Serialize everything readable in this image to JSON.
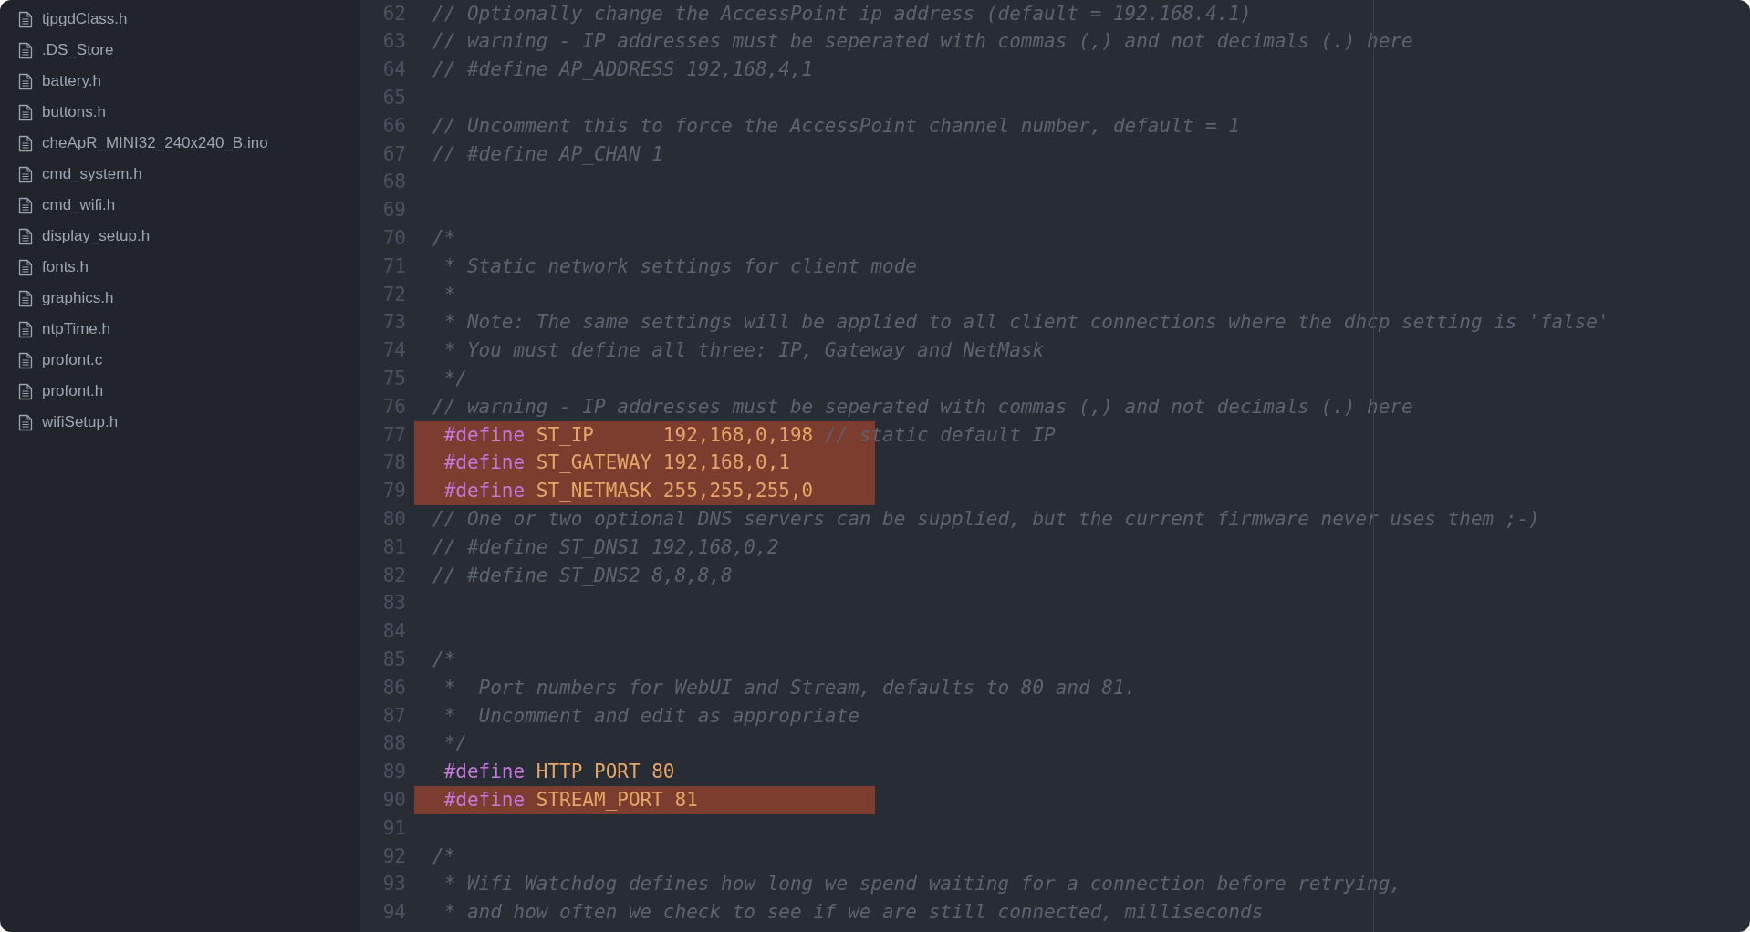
{
  "sidebar": {
    "tree": [
      {
        "children": [
          {
            "name": "tjpgdClass.h"
          }
        ]
      },
      {
        "name": ".DS_Store"
      },
      {
        "name": "battery.h"
      },
      {
        "name": "buttons.h"
      },
      {
        "name": "cheApR_MINI32_240x240_B.ino"
      },
      {
        "name": "cmd_system.h"
      },
      {
        "name": "cmd_wifi.h"
      },
      {
        "name": "display_setup.h"
      },
      {
        "name": "fonts.h"
      },
      {
        "name": "graphics.h"
      },
      {
        "name": "ntpTime.h"
      },
      {
        "name": "profont.c"
      },
      {
        "name": "profont.h"
      },
      {
        "name": "wifiSetup.h"
      }
    ]
  },
  "editor": {
    "lines": [
      {
        "number": "62",
        "highlighted": false,
        "tokens": [
          {
            "kind": "comment",
            "text": "// Optionally change the AccessPoint ip address (default = 192.168.4.1)"
          }
        ]
      },
      {
        "number": "63",
        "highlighted": false,
        "tokens": [
          {
            "kind": "comment",
            "text": "// warning - IP addresses must be seperated with commas (,) and not decimals (.) here"
          }
        ]
      },
      {
        "number": "64",
        "highlighted": false,
        "tokens": [
          {
            "kind": "comment",
            "text": "// #define AP_ADDRESS 192,168,4,1"
          }
        ]
      },
      {
        "number": "65",
        "highlighted": false
      },
      {
        "number": "66",
        "highlighted": false,
        "tokens": [
          {
            "kind": "comment",
            "text": "// Uncomment this to force the AccessPoint channel number, default = 1"
          }
        ]
      },
      {
        "number": "67",
        "highlighted": false,
        "tokens": [
          {
            "kind": "comment",
            "text": "// #define AP_CHAN 1"
          }
        ]
      },
      {
        "number": "68",
        "highlighted": false
      },
      {
        "number": "69",
        "highlighted": false
      },
      {
        "number": "70",
        "highlighted": false,
        "tokens": [
          {
            "kind": "comment",
            "text": "/*"
          }
        ]
      },
      {
        "number": "71",
        "highlighted": false,
        "tokens": [
          {
            "kind": "comment",
            "text": " * Static network settings for client mode"
          }
        ]
      },
      {
        "number": "72",
        "highlighted": false,
        "tokens": [
          {
            "kind": "comment",
            "text": " *"
          }
        ]
      },
      {
        "number": "73",
        "highlighted": false,
        "tokens": [
          {
            "kind": "comment",
            "text": " * Note: The same settings will be applied to all client connections where the dhcp setting is 'false'"
          }
        ]
      },
      {
        "number": "74",
        "highlighted": false,
        "tokens": [
          {
            "kind": "comment",
            "text": " * You must define all three: IP, Gateway and NetMask"
          }
        ]
      },
      {
        "number": "75",
        "highlighted": false,
        "tokens": [
          {
            "kind": "comment",
            "text": " */"
          }
        ]
      },
      {
        "number": "76",
        "highlighted": false,
        "tokens": [
          {
            "kind": "comment",
            "text": "// warning - IP addresses must be seperated with commas (,) and not decimals (.) here"
          }
        ]
      },
      {
        "number": "77",
        "highlighted": true,
        "tokens": [
          {
            "kind": "keyword",
            "text": " #define"
          },
          {
            "kind": "constant",
            "text": " ST_IP      192,168,0,198"
          },
          {
            "kind": "comment",
            "text": " // static default IP"
          }
        ]
      },
      {
        "number": "78",
        "highlighted": true,
        "tokens": [
          {
            "kind": "keyword",
            "text": " #define"
          },
          {
            "kind": "constant",
            "text": " ST_GATEWAY 192,168,0,1"
          }
        ]
      },
      {
        "number": "79",
        "highlighted": true,
        "tokens": [
          {
            "kind": "keyword",
            "text": " #define"
          },
          {
            "kind": "constant",
            "text": " ST_NETMASK 255,255,255,0"
          }
        ]
      },
      {
        "number": "80",
        "highlighted": false,
        "tokens": [
          {
            "kind": "comment",
            "text": "// One or two optional DNS servers can be supplied, but the current firmware never uses them ;-)"
          }
        ]
      },
      {
        "number": "81",
        "highlighted": false,
        "tokens": [
          {
            "kind": "comment",
            "text": "// #define ST_DNS1 192,168,0,2"
          }
        ]
      },
      {
        "number": "82",
        "highlighted": false,
        "tokens": [
          {
            "kind": "comment",
            "text": "// #define ST_DNS2 8,8,8,8"
          }
        ]
      },
      {
        "number": "83",
        "highlighted": false
      },
      {
        "number": "84",
        "highlighted": false
      },
      {
        "number": "85",
        "highlighted": false,
        "tokens": [
          {
            "kind": "comment",
            "text": "/*"
          }
        ]
      },
      {
        "number": "86",
        "highlighted": false,
        "tokens": [
          {
            "kind": "comment",
            "text": " *  Port numbers for WebUI and Stream, defaults to 80 and 81."
          }
        ]
      },
      {
        "number": "87",
        "highlighted": false,
        "tokens": [
          {
            "kind": "comment",
            "text": " *  Uncomment and edit as appropriate"
          }
        ]
      },
      {
        "number": "88",
        "highlighted": false,
        "tokens": [
          {
            "kind": "comment",
            "text": " */"
          }
        ]
      },
      {
        "number": "89",
        "highlighted": false,
        "tokens": [
          {
            "kind": "keyword",
            "text": " #define"
          },
          {
            "kind": "constant",
            "text": " HTTP_PORT 80"
          }
        ]
      },
      {
        "number": "90",
        "highlighted": true,
        "tokens": [
          {
            "kind": "keyword",
            "text": " #define"
          },
          {
            "kind": "constant",
            "text": " STREAM_PORT 81"
          }
        ]
      },
      {
        "number": "91",
        "highlighted": false
      },
      {
        "number": "92",
        "highlighted": false,
        "tokens": [
          {
            "kind": "comment",
            "text": "/*"
          }
        ]
      },
      {
        "number": "93",
        "highlighted": false,
        "tokens": [
          {
            "kind": "comment",
            "text": " * Wifi Watchdog defines how long we spend waiting for a connection before retrying,"
          }
        ]
      },
      {
        "number": "94",
        "highlighted": false,
        "tokens": [
          {
            "kind": "comment",
            "text": " * and how often we check to see if we are still connected, milliseconds"
          }
        ]
      }
    ]
  }
}
